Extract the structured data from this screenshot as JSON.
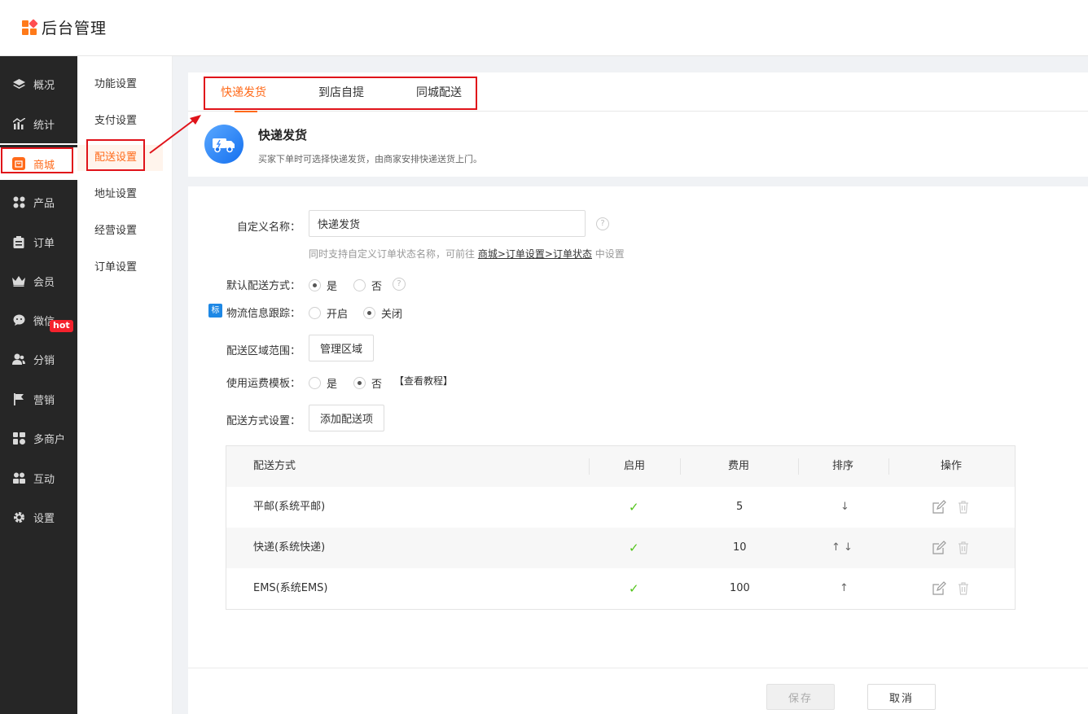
{
  "app": {
    "title": "后台管理"
  },
  "sidebar": {
    "items": [
      {
        "label": "概况",
        "icon": "layers-icon"
      },
      {
        "label": "统计",
        "icon": "chart-icon"
      },
      {
        "label": "商城",
        "icon": "shop-icon"
      },
      {
        "label": "产品",
        "icon": "grid-icon"
      },
      {
        "label": "订单",
        "icon": "clipboard-icon"
      },
      {
        "label": "会员",
        "icon": "crown-icon"
      },
      {
        "label": "微信",
        "icon": "wechat-icon"
      },
      {
        "label": "分销",
        "icon": "users-icon"
      },
      {
        "label": "营销",
        "icon": "flag-icon"
      },
      {
        "label": "多商户",
        "icon": "store-icon"
      },
      {
        "label": "互动",
        "icon": "interact-icon"
      },
      {
        "label": "设置",
        "icon": "gear-icon"
      }
    ],
    "hot_badge": "hot",
    "accent": "#ff6a1a"
  },
  "subnav": {
    "items": [
      "功能设置",
      "支付设置",
      "配送设置",
      "地址设置",
      "经营设置",
      "订单设置"
    ]
  },
  "tabs": [
    "快递发货",
    "到店自提",
    "同城配送"
  ],
  "info": {
    "title": "快递发货",
    "desc": "买家下单时可选择快递发货，由商家安排快递送货上门。"
  },
  "form": {
    "name_label": "自定义名称：",
    "name_value": "快递发货",
    "hint_prefix": "同时支持自定义订单状态名称，可前往",
    "hint_link": "商城>订单设置>订单状态",
    "hint_suffix": "中设置",
    "default_label": "默认配送方式：",
    "yes": "是",
    "no": "否",
    "tracking_badge": "标",
    "tracking_label": "物流信息跟踪：",
    "on": "开启",
    "off": "关闭",
    "area_label": "配送区域范围：",
    "area_button": "管理区域",
    "template_label": "使用运费模板：",
    "tutorial": "【查看教程】",
    "method_label": "配送方式设置：",
    "add_button": "添加配送项",
    "help": "?"
  },
  "table": {
    "headers": [
      "配送方式",
      "启用",
      "费用",
      "排序",
      "操作"
    ],
    "rows": [
      {
        "name": "平邮(系统平邮)",
        "enabled": "✓",
        "fee": "5",
        "sort": "↓"
      },
      {
        "name": "快递(系统快递)",
        "enabled": "✓",
        "fee": "10",
        "sort": "↑ ↓"
      },
      {
        "name": "EMS(系统EMS)",
        "enabled": "✓",
        "fee": "100",
        "sort": "↑"
      }
    ]
  },
  "footer": {
    "save": "保存",
    "cancel": "取消"
  }
}
